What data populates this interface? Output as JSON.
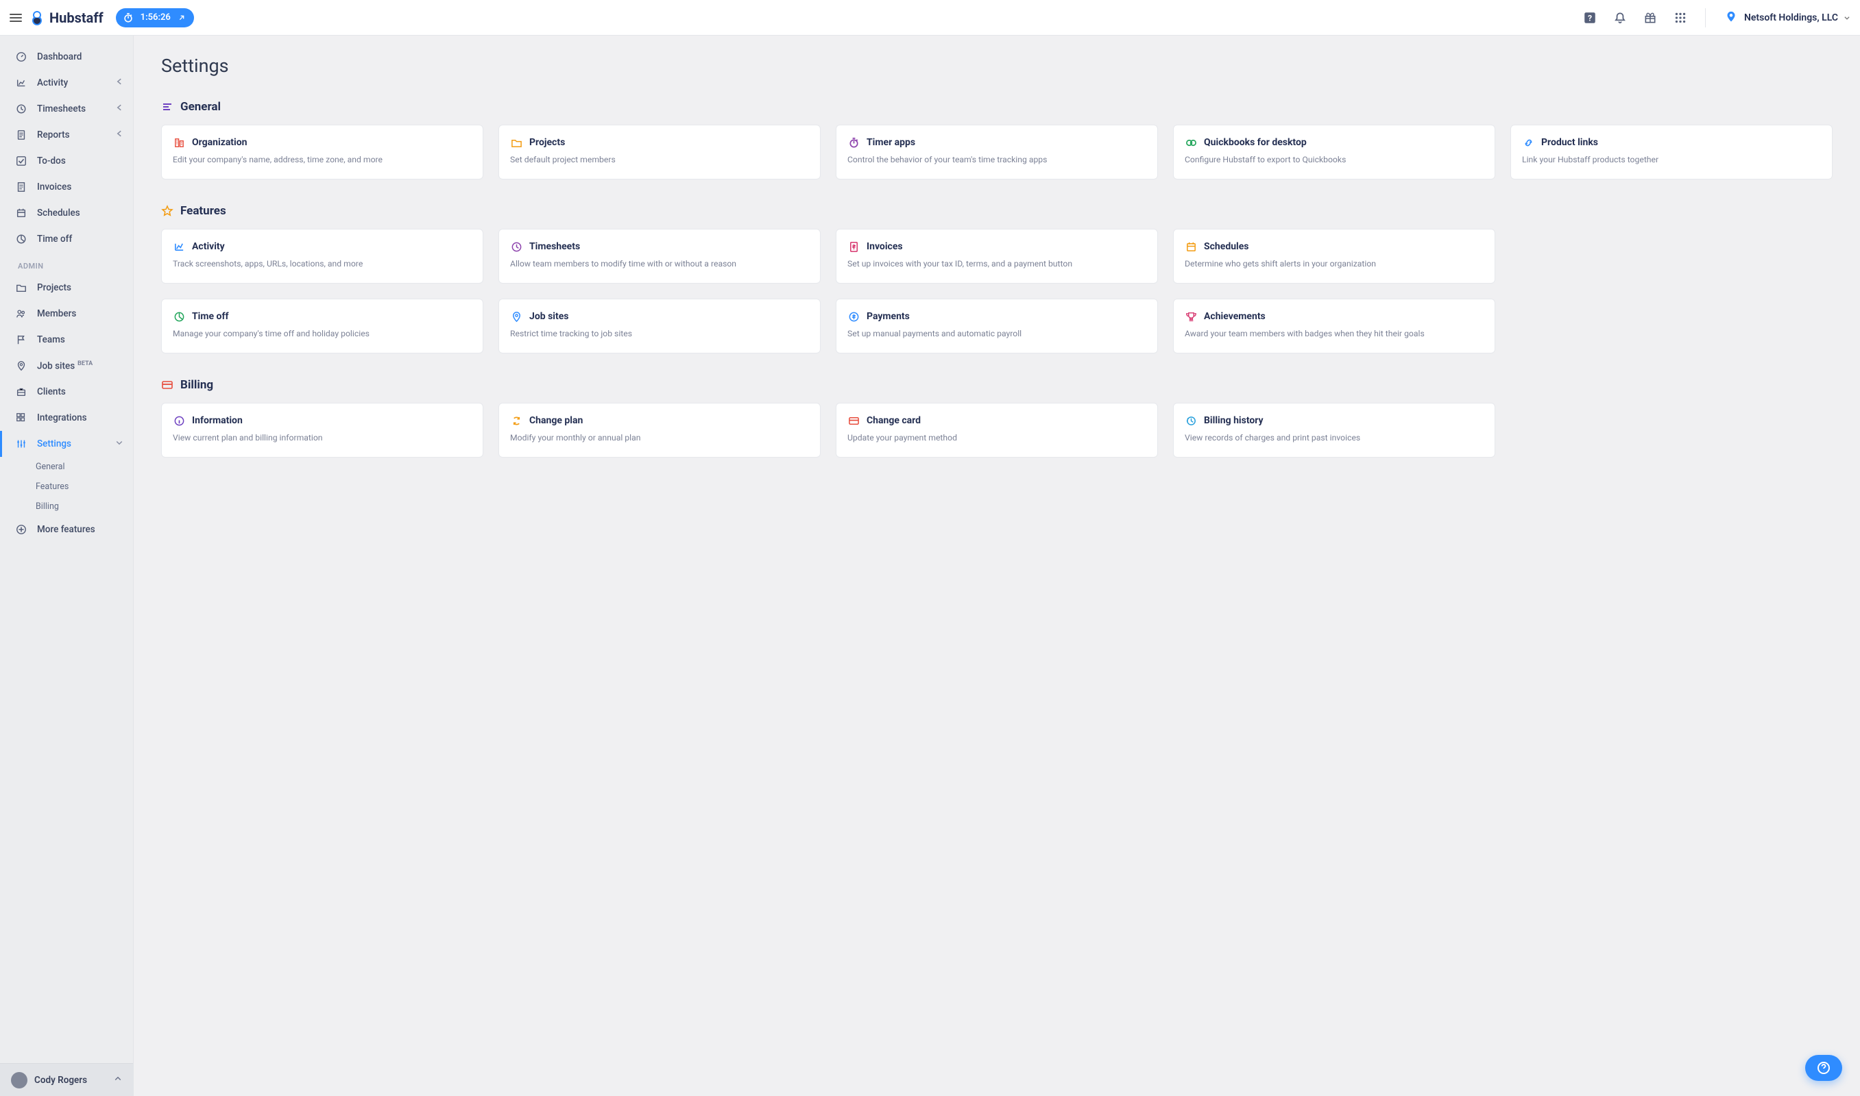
{
  "header": {
    "brand": "Hubstaff",
    "timer": "1:56:26",
    "org_name": "Netsoft Holdings, LLC"
  },
  "sidebar": {
    "items": [
      {
        "label": "Dashboard",
        "icon": "gauge"
      },
      {
        "label": "Activity",
        "icon": "chart",
        "expandable": true
      },
      {
        "label": "Timesheets",
        "icon": "clock",
        "expandable": true
      },
      {
        "label": "Reports",
        "icon": "doc",
        "expandable": true
      },
      {
        "label": "To-dos",
        "icon": "check"
      },
      {
        "label": "Invoices",
        "icon": "receipt"
      },
      {
        "label": "Schedules",
        "icon": "calendar"
      },
      {
        "label": "Time off",
        "icon": "pie"
      }
    ],
    "admin_label": "ADMIN",
    "admin_items": [
      {
        "label": "Projects",
        "icon": "folder"
      },
      {
        "label": "Members",
        "icon": "people"
      },
      {
        "label": "Teams",
        "icon": "flag"
      },
      {
        "label": "Job sites",
        "icon": "pin",
        "badge": "BETA"
      },
      {
        "label": "Clients",
        "icon": "briefcase"
      },
      {
        "label": "Integrations",
        "icon": "blocks"
      },
      {
        "label": "Settings",
        "icon": "sliders",
        "active": true,
        "expandable": true,
        "children": [
          "General",
          "Features",
          "Billing"
        ]
      },
      {
        "label": "More features",
        "icon": "plus"
      }
    ],
    "user_name": "Cody Rogers"
  },
  "page": {
    "title": "Settings",
    "sections": [
      {
        "key": "general",
        "title": "General",
        "header_icon": "lines-purple",
        "cards": [
          {
            "icon": "org",
            "icon_color": "c-red",
            "title": "Organization",
            "desc": "Edit your company's name, address, time zone, and more"
          },
          {
            "icon": "folder",
            "icon_color": "c-orange",
            "title": "Projects",
            "desc": "Set default project members"
          },
          {
            "icon": "stopwatch",
            "icon_color": "c-purple",
            "title": "Timer apps",
            "desc": "Control the behavior of your team's time tracking apps"
          },
          {
            "icon": "qb",
            "icon_color": "c-green",
            "title": "Quickbooks for desktop",
            "desc": "Configure Hubstaff to export to Quickbooks"
          },
          {
            "icon": "link",
            "icon_color": "c-blue",
            "title": "Product links",
            "desc": "Link your Hubstaff products together"
          }
        ]
      },
      {
        "key": "features",
        "title": "Features",
        "header_icon": "star-orange",
        "cards": [
          {
            "icon": "activity",
            "icon_color": "c-blue",
            "title": "Activity",
            "desc": "Track screenshots, apps, URLs, locations, and more"
          },
          {
            "icon": "clock",
            "icon_color": "c-purple",
            "title": "Timesheets",
            "desc": "Allow team members to modify time with or without a reason"
          },
          {
            "icon": "invoice",
            "icon_color": "c-pink",
            "title": "Invoices",
            "desc": "Set up invoices with your tax ID, terms, and a payment button"
          },
          {
            "icon": "calendar",
            "icon_color": "c-orange",
            "title": "Schedules",
            "desc": "Determine who gets shift alerts in your organization"
          },
          {
            "icon": "pie",
            "icon_color": "c-green",
            "title": "Time off",
            "desc": "Manage your company's time off and holiday policies"
          },
          {
            "icon": "pin",
            "icon_color": "c-blue",
            "title": "Job sites",
            "desc": "Restrict time tracking to job sites"
          },
          {
            "icon": "money",
            "icon_color": "c-blue",
            "title": "Payments",
            "desc": "Set up manual payments and automatic payroll"
          },
          {
            "icon": "trophy",
            "icon_color": "c-pink",
            "title": "Achievements",
            "desc": "Award your team members with badges when they hit their goals"
          }
        ]
      },
      {
        "key": "billing",
        "title": "Billing",
        "header_icon": "card-red",
        "cards": [
          {
            "icon": "info",
            "icon_color": "c-plum",
            "title": "Information",
            "desc": "View current plan and billing information"
          },
          {
            "icon": "swap",
            "icon_color": "c-orange",
            "title": "Change plan",
            "desc": "Modify your monthly or annual plan"
          },
          {
            "icon": "creditcard",
            "icon_color": "c-red",
            "title": "Change card",
            "desc": "Update your payment method"
          },
          {
            "icon": "history",
            "icon_color": "c-sky",
            "title": "Billing history",
            "desc": "View records of charges and print past invoices"
          }
        ]
      }
    ]
  }
}
